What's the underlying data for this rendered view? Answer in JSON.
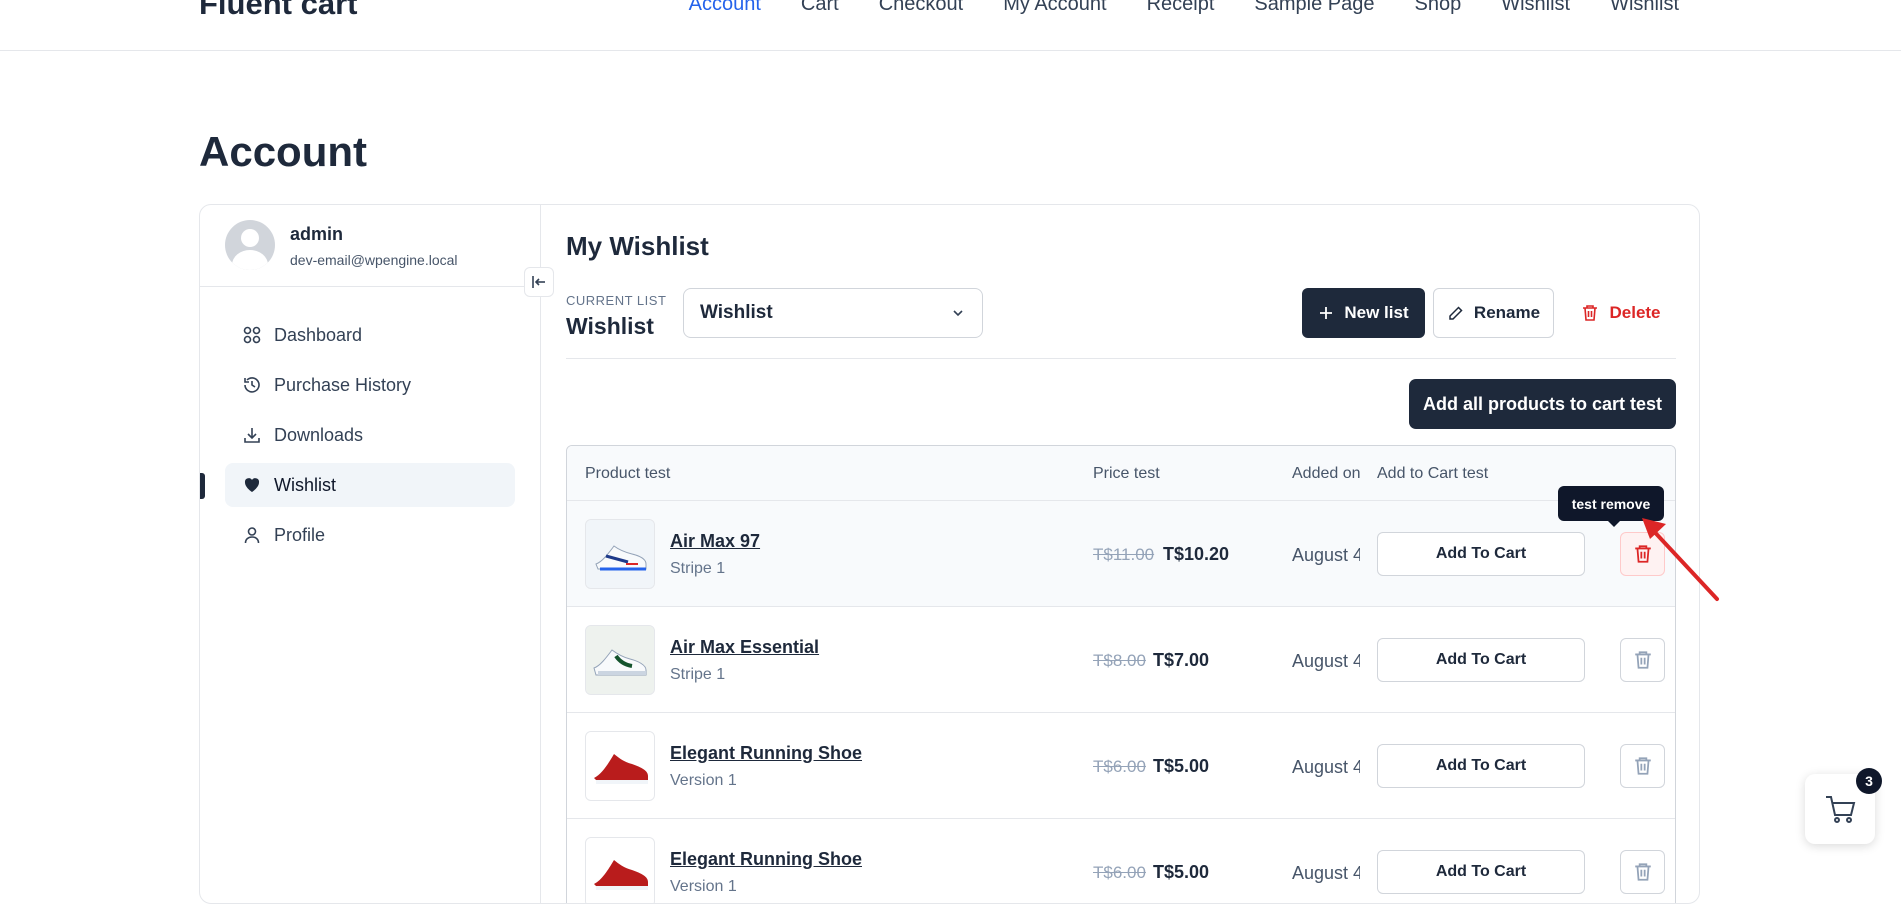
{
  "site": {
    "logo": "Fluent cart",
    "nav": [
      "Account",
      "Cart",
      "Checkout",
      "My Account",
      "Receipt",
      "Sample Page",
      "Shop",
      "Wishlist",
      "Wishlist"
    ]
  },
  "page": {
    "title": "Account"
  },
  "user": {
    "name": "admin",
    "email": "dev-email@wpengine.local"
  },
  "sidebar": {
    "items": [
      {
        "label": "Dashboard",
        "icon": "dashboard-icon"
      },
      {
        "label": "Purchase History",
        "icon": "history-icon"
      },
      {
        "label": "Downloads",
        "icon": "download-icon"
      },
      {
        "label": "Wishlist",
        "icon": "heart-icon",
        "active": true
      },
      {
        "label": "Profile",
        "icon": "user-icon"
      }
    ]
  },
  "wishlist": {
    "title": "My Wishlist",
    "current_list_label": "CURRENT LIST",
    "current_list_name": "Wishlist",
    "select_value": "Wishlist",
    "new_list": "New list",
    "rename": "Rename",
    "delete": "Delete",
    "add_all": "Add all products to cart test",
    "columns": {
      "product": "Product test",
      "price": "Price test",
      "added": "Added on",
      "add_to_cart": "Add to Cart test"
    },
    "rows": [
      {
        "name": "Air Max 97",
        "variant": "Stripe 1",
        "old_price": "T$11.00",
        "price": "T$10.20",
        "added": "August 4",
        "cta": "Add To Cart",
        "shoe": "white-blue"
      },
      {
        "name": "Air Max Essential",
        "variant": "Stripe 1",
        "old_price": "T$8.00",
        "price": "T$7.00",
        "added": "August 4",
        "cta": "Add To Cart",
        "shoe": "white-green"
      },
      {
        "name": "Elegant Running Shoe",
        "variant": "Version 1",
        "old_price": "T$6.00",
        "price": "T$5.00",
        "added": "August 4",
        "cta": "Add To Cart",
        "shoe": "red"
      },
      {
        "name": "Elegant Running Shoe",
        "variant": "Version 1",
        "old_price": "T$6.00",
        "price": "T$5.00",
        "added": "August 4",
        "cta": "Add To Cart",
        "shoe": "red"
      }
    ],
    "tooltip": "test remove"
  },
  "floating_cart": {
    "count": "3"
  },
  "colors": {
    "dark": "#1e293b",
    "danger": "#dc2626",
    "accent": "#2563eb"
  }
}
